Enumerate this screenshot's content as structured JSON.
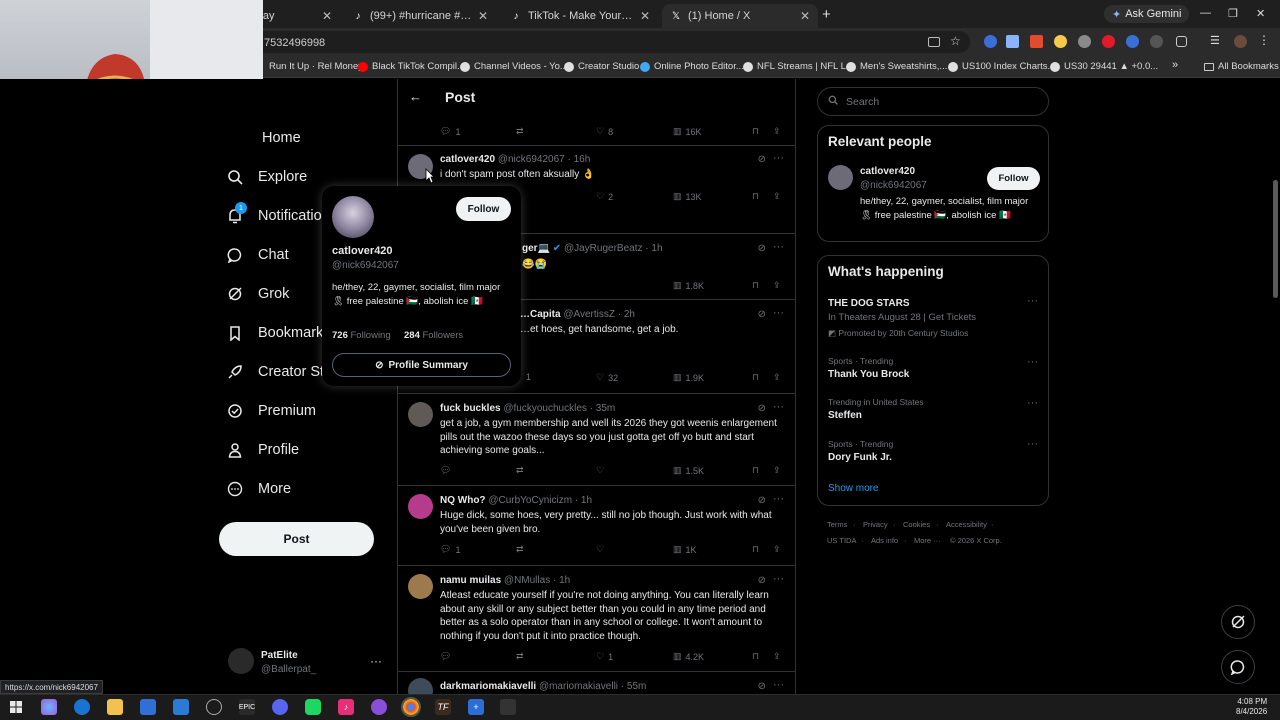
{
  "browser": {
    "tabs": [
      {
        "title": "our Day",
        "icon": "tiktok-icon"
      },
      {
        "title": "(99+) #hurricane #jamaica #we...",
        "icon": "tiktok-icon"
      },
      {
        "title": "TikTok - Make Your Day",
        "icon": "tiktok-icon"
      },
      {
        "title": "(1) Home / X",
        "icon": "x-logo-icon"
      }
    ],
    "new_tab": "+",
    "ask_gemini": "Ask Gemini",
    "url_fragment": "7532496998",
    "bookmarks": [
      {
        "label": "Run It Up · Rel Money",
        "color": "#ff0000"
      },
      {
        "label": "Black TikTok Compil...",
        "color": "#ff0000"
      },
      {
        "label": "Channel Videos - Yo...",
        "color": "#e0e0e0"
      },
      {
        "label": "Creator Studio",
        "color": "#e0e0e0"
      },
      {
        "label": "Online Photo Editor...",
        "color": "#3fa9f5"
      },
      {
        "label": "NFL Streams | NFL L...",
        "color": "#e0e0e0"
      },
      {
        "label": "Men's Sweatshirts,...",
        "color": "#e0e0e0"
      },
      {
        "label": "US100 Index Charts...",
        "color": "#e0e0e0"
      },
      {
        "label": "US30 29441 ▲ +0.0...",
        "color": "#e0e0e0"
      }
    ],
    "bookmarks_more": "»",
    "all_bookmarks": "All Bookmarks",
    "status_url": "https://x.com/nick6942067"
  },
  "sidebar": {
    "items": [
      {
        "label": "Home",
        "icon": "home-icon"
      },
      {
        "label": "Explore",
        "icon": "search-icon"
      },
      {
        "label": "Notifications",
        "icon": "bell-icon",
        "badge": "1"
      },
      {
        "label": "Chat",
        "icon": "chat-icon"
      },
      {
        "label": "Grok",
        "icon": "grok-icon"
      },
      {
        "label": "Bookmarks",
        "icon": "bookmark-icon"
      },
      {
        "label": "Creator Studio",
        "icon": "rocket-icon"
      },
      {
        "label": "Premium",
        "icon": "premium-icon"
      },
      {
        "label": "Profile",
        "icon": "person-icon"
      },
      {
        "label": "More",
        "icon": "more-circle-icon"
      }
    ],
    "post_button": "Post",
    "account": {
      "name": "PatElite",
      "handle": "@Ballerpat_",
      "more": "···"
    }
  },
  "header": {
    "back": "←",
    "title": "Post"
  },
  "top_actions": {
    "replies": "1",
    "reposts": "",
    "likes": "8",
    "views": "16K"
  },
  "tweets": [
    {
      "name": "catlover420",
      "handle": "@nick6942067",
      "time": "· 16h",
      "text": "i don't spam post often aksually 👌",
      "replies": "",
      "reposts": "",
      "likes": "2",
      "views": "13K"
    },
    {
      "name": "…ger💻",
      "handle": "@JayRugerBeatz",
      "time": "· 1h",
      "text": "😂😭",
      "replies": "",
      "reposts": "",
      "likes": "",
      "views": "1.8K",
      "verified": true
    },
    {
      "name": "…Capita",
      "handle": "@AvertissZ",
      "time": "· 2h",
      "text": "…et hoes, get handsome, get a job.",
      "replies": "",
      "reposts": "1",
      "likes": "32",
      "views": "1.9K"
    },
    {
      "name": "fuck buckles",
      "handle": "@fuckyouchuckles",
      "time": "· 35m",
      "text": "get a job, a gym membership and well its 2026 they got weenis enlargement pills out the wazoo these days so you just gotta get off yo butt and start achieving some goals...",
      "replies": "",
      "reposts": "",
      "likes": "",
      "views": "1.5K"
    },
    {
      "name": "NQ Who?",
      "handle": "@CurbYoCynicizm",
      "time": "· 1h",
      "text": "Huge dick, some hoes, very pretty... still no job though. Just work with what you've been given bro.",
      "replies": "1",
      "reposts": "",
      "likes": "",
      "views": "1K"
    },
    {
      "name": "namu muilas",
      "handle": "@NMullas",
      "time": "· 1h",
      "text": "Atleast educate yourself if you're not doing anything. You can literally learn about any skill or any subject better than you could in any time period and better as a solo operator than in any school or college. It won't amount to nothing if you don't put it into practice though.",
      "replies": "",
      "reposts": "",
      "likes": "1",
      "views": "4.2K"
    },
    {
      "name": "darkmariomakiavelli",
      "handle": "@mariomakiavelli",
      "time": "· 55m",
      "text": "",
      "replies": "",
      "reposts": "",
      "likes": "",
      "views": ""
    }
  ],
  "hover_card": {
    "name": "catlover420",
    "handle": "@nick6942067",
    "follow": "Follow",
    "bio": "he/they, 22, gaymer, socialist, film major 🎗 free palestine 🇵🇸, abolish ice 🇲🇽",
    "following_count": "726",
    "following_label": "Following",
    "followers_count": "284",
    "followers_label": "Followers",
    "summary_button": "Profile Summary"
  },
  "right": {
    "search_placeholder": "Search",
    "relevant": {
      "title": "Relevant people",
      "name": "catlover420",
      "handle": "@nick6942067",
      "follow": "Follow",
      "bio": "he/they, 22, gaymer, socialist, film major 🎗 free palestine 🇵🇸, abolish ice 🇲🇽"
    },
    "happening": {
      "title": "What's happening",
      "promo": {
        "name": "THE DOG STARS",
        "line": "In Theaters August 28 | Get Tickets",
        "by": "Promoted by 20th Century Studios"
      },
      "trends": [
        {
          "category": "Sports · Trending",
          "name": "Thank You Brock"
        },
        {
          "category": "Trending in United States",
          "name": "Steffen"
        },
        {
          "category": "Sports · Trending",
          "name": "Dory Funk Jr."
        }
      ],
      "show_more": "Show more"
    },
    "footer": [
      "Terms",
      "·",
      "Privacy",
      "·",
      "Cookies",
      "·",
      "Accessibility",
      "·",
      "US TIDA",
      "·",
      "Ads info",
      "·",
      "More ···",
      "© 2026 X Corp."
    ]
  },
  "taskbar": {
    "time": "4:08 PM",
    "date": "8/4/2026"
  },
  "colors": {
    "accent": "#1d9bf0",
    "bg": "#000000",
    "border": "#2f3336",
    "muted": "#71767b",
    "text": "#e7e9ea"
  }
}
